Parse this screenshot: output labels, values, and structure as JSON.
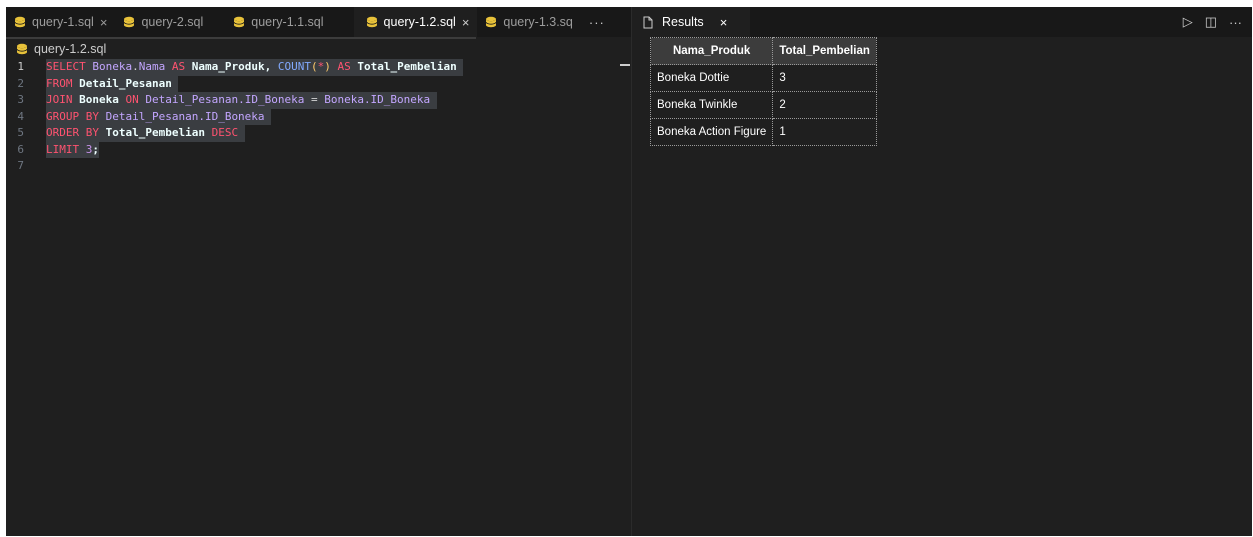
{
  "editor": {
    "tabs": [
      {
        "label": "query-1.sql",
        "close": "×",
        "active": false
      },
      {
        "label": "query-2.sql",
        "close": "",
        "active": false
      },
      {
        "label": "query-1.1.sql",
        "close": "",
        "active": false
      },
      {
        "label": "query-1.2.sql",
        "close": "×",
        "active": true
      },
      {
        "label": "query-1.3.sq",
        "close": "",
        "active": false
      }
    ],
    "more": "···",
    "breadcrumb": "query-1.2.sql",
    "line_numbers": [
      "1",
      "2",
      "3",
      "4",
      "5",
      "6",
      "7"
    ],
    "code": {
      "l1": {
        "select": "SELECT",
        "table": "Boneka",
        "dot": ".",
        "field": "Nama",
        "as1": "AS",
        "alias": "Nama_Produk,",
        "count": "COUNT",
        "paren_open": "(",
        "star": "*",
        "paren_close": ")",
        "as2": "AS",
        "alias2": "Total_Pembelian"
      },
      "l2": {
        "from": "FROM",
        "table": "Detail_Pesanan"
      },
      "l3": {
        "join": "JOIN",
        "table": "Boneka",
        "on": "ON",
        "left": "Detail_Pesanan.ID_Boneka",
        "eq": "=",
        "right": "Boneka.ID_Boneka"
      },
      "l4": {
        "group": "GROUP BY",
        "col": "Detail_Pesanan.ID_Boneka"
      },
      "l5": {
        "order": "ORDER BY",
        "col": "Total_Pembelian",
        "desc": "DESC"
      },
      "l6": {
        "limit": "LIMIT",
        "num": "3",
        "semi": ";"
      }
    }
  },
  "results": {
    "tab_label": "Results",
    "tab_close": "×",
    "actions": {
      "run": "▷",
      "split": "◫",
      "more": "···"
    },
    "columns": [
      "Nama_Produk",
      "Total_Pembelian"
    ],
    "rows": [
      [
        "Boneka Dottie",
        "3"
      ],
      [
        "Boneka Twinkle",
        "2"
      ],
      [
        "Boneka Action Figure",
        "1"
      ]
    ]
  },
  "colors": {
    "db_icon": "#e8c23a",
    "background": "#1f1f1f",
    "tabbar": "#181818"
  }
}
